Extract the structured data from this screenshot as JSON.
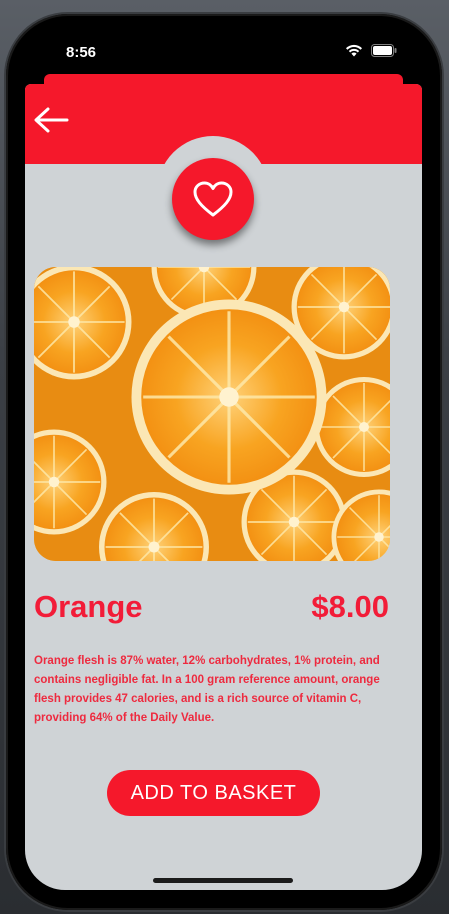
{
  "status_bar": {
    "time": "8:56",
    "icons": [
      "wifi-icon",
      "battery-icon"
    ]
  },
  "header": {
    "back_icon": "arrow-left-icon",
    "favorite_icon": "heart-icon",
    "accent_color": "#f5182b"
  },
  "product": {
    "image": "orange-slices-photo",
    "name": "Orange",
    "price": "$8.00",
    "description": "Orange flesh is 87% water, 12% carbohydrates, 1% protein, and contains negligible fat. In a 100 gram reference amount, orange flesh provides 47 calories, and is a rich source of vitamin C, providing 64% of the Daily Value."
  },
  "actions": {
    "add_to_basket_label": "ADD TO BASKET"
  },
  "colors": {
    "background": "#cfd3d6",
    "text_accent": "#f21c38"
  }
}
